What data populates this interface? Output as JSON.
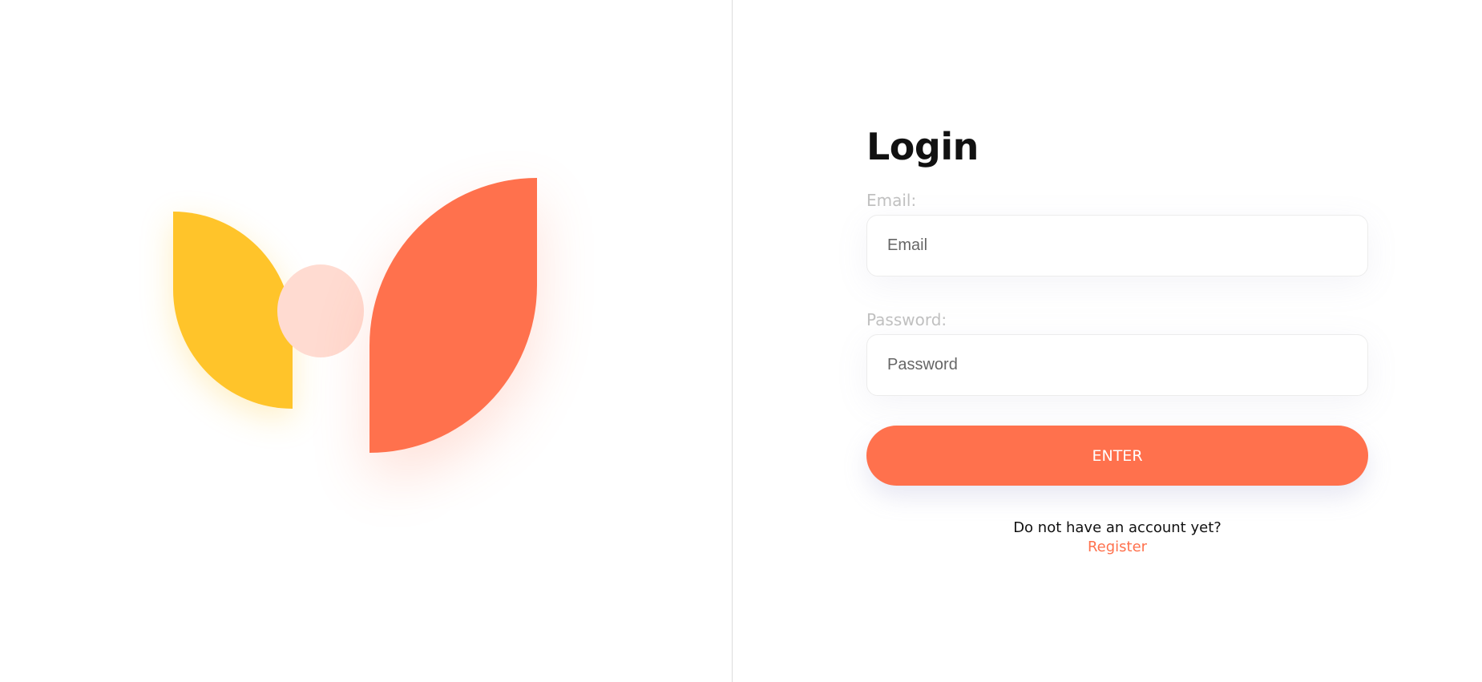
{
  "colors": {
    "accent": "#ff714d",
    "logo_yellow": "#ffc42a",
    "logo_circle": "#ffdbd1",
    "label_gray": "#c0c0c0"
  },
  "login": {
    "title": "Login",
    "email": {
      "label": "Email:",
      "placeholder": "Email",
      "value": ""
    },
    "password": {
      "label": "Password:",
      "placeholder": "Password",
      "value": ""
    },
    "submit_label": "ENTER",
    "register_prompt": "Do not have an account yet?",
    "register_link": "Register"
  }
}
